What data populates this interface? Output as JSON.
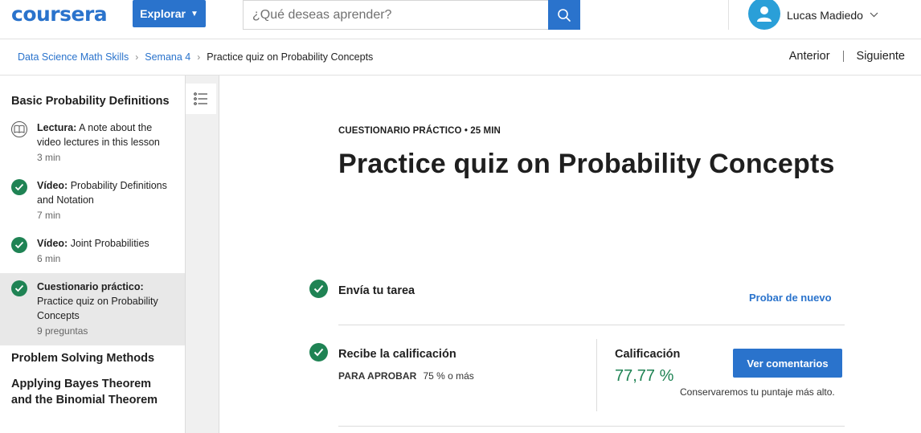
{
  "header": {
    "logo_text": "coursera",
    "explore_label": "Explorar",
    "search_placeholder": "¿Qué deseas aprender?",
    "user_name": "Lucas Madiedo"
  },
  "breadcrumb": {
    "items": [
      "Data Science Math Skills",
      "Semana 4"
    ],
    "current": "Practice quiz on Probability Concepts"
  },
  "nav": {
    "previous": "Anterior",
    "next": "Siguiente"
  },
  "sidebar": {
    "section_title": "Basic Probability Definitions",
    "items": [
      {
        "type": "Lectura:",
        "title": "A note about the video lectures in this lesson",
        "meta": "3 min",
        "icon": "book-icon",
        "status": "not-started"
      },
      {
        "type": "Vídeo:",
        "title": "Probability Definitions and Notation",
        "meta": "7 min",
        "icon": "check-icon",
        "status": "completed"
      },
      {
        "type": "Vídeo:",
        "title": "Joint Probabilities",
        "meta": "6 min",
        "icon": "check-icon",
        "status": "completed"
      },
      {
        "type": "Cuestionario práctico:",
        "title": "Practice quiz on Probability Concepts",
        "meta": "9 preguntas",
        "icon": "check-icon",
        "status": "completed",
        "active": true
      }
    ],
    "more_sections": [
      "Problem Solving Methods",
      "Applying Bayes Theorem and the Binomial Theorem"
    ]
  },
  "main": {
    "eyebrow": "CUESTIONARIO PRÁCTICO • 25 MIN",
    "title": "Practice quiz on Probability Concepts",
    "submit_step": {
      "label": "Envía tu tarea",
      "action": "Probar de nuevo"
    },
    "grade_step": {
      "label": "Recibe la calificación",
      "pass_caption": "PARA APROBAR",
      "pass_value": "75 % o más",
      "grade_caption": "Calificación",
      "grade_value": "77,77 %",
      "feedback_button": "Ver comentarios",
      "keep_note": "Conservaremos tu puntaje más alto."
    }
  },
  "colors": {
    "brand_blue": "#2a73cc",
    "success_green": "#1f8354",
    "avatar_blue": "#2a9fd8"
  }
}
